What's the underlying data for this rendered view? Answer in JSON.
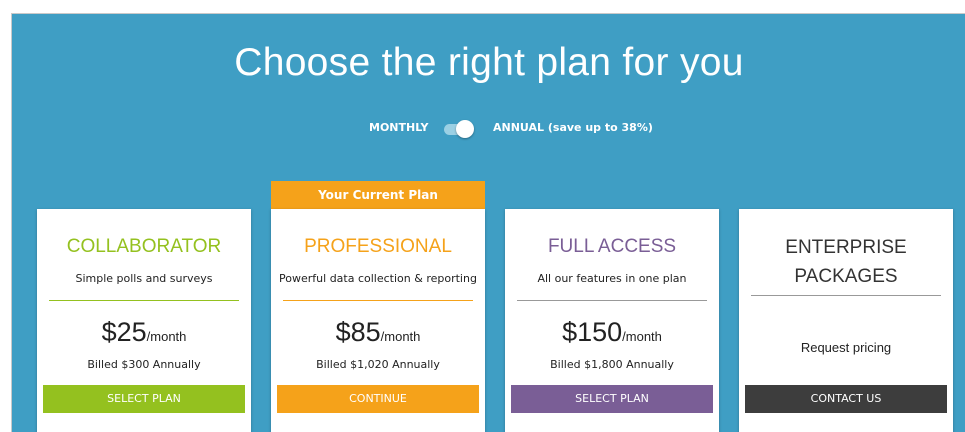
{
  "header": {
    "title": "Choose the right plan for you"
  },
  "billing_toggle": {
    "monthly_label": "MONTHLY",
    "annual_label": "ANNUAL (save up to 38%)",
    "selected": "annual"
  },
  "current_plan_ribbon": "Your Current Plan",
  "plans": [
    {
      "name": "COLLABORATOR",
      "description": "Simple polls and surveys",
      "price": "$25",
      "period": "/month",
      "billed": "Billed $300 Annually",
      "button": "SELECT PLAN",
      "color": "#94c11f"
    },
    {
      "name": "PROFESSIONAL",
      "description": "Powerful data collection & reporting",
      "price": "$85",
      "period": "/month",
      "billed": "Billed $1,020 Annually",
      "button": "CONTINUE",
      "color": "#f5a21a"
    },
    {
      "name": "FULL ACCESS",
      "description": "All our features in one plan",
      "price": "$150",
      "period": "/month",
      "billed": "Billed $1,800 Annually",
      "button": "SELECT PLAN",
      "color": "#7a5e96"
    },
    {
      "name_line1": "ENTERPRISE",
      "name_line2": "PACKAGES",
      "request": "Request pricing",
      "button": "CONTACT US",
      "color": "#3d3d3d"
    }
  ],
  "colors": {
    "background": "#3f9ec4",
    "card": "#ffffff"
  }
}
